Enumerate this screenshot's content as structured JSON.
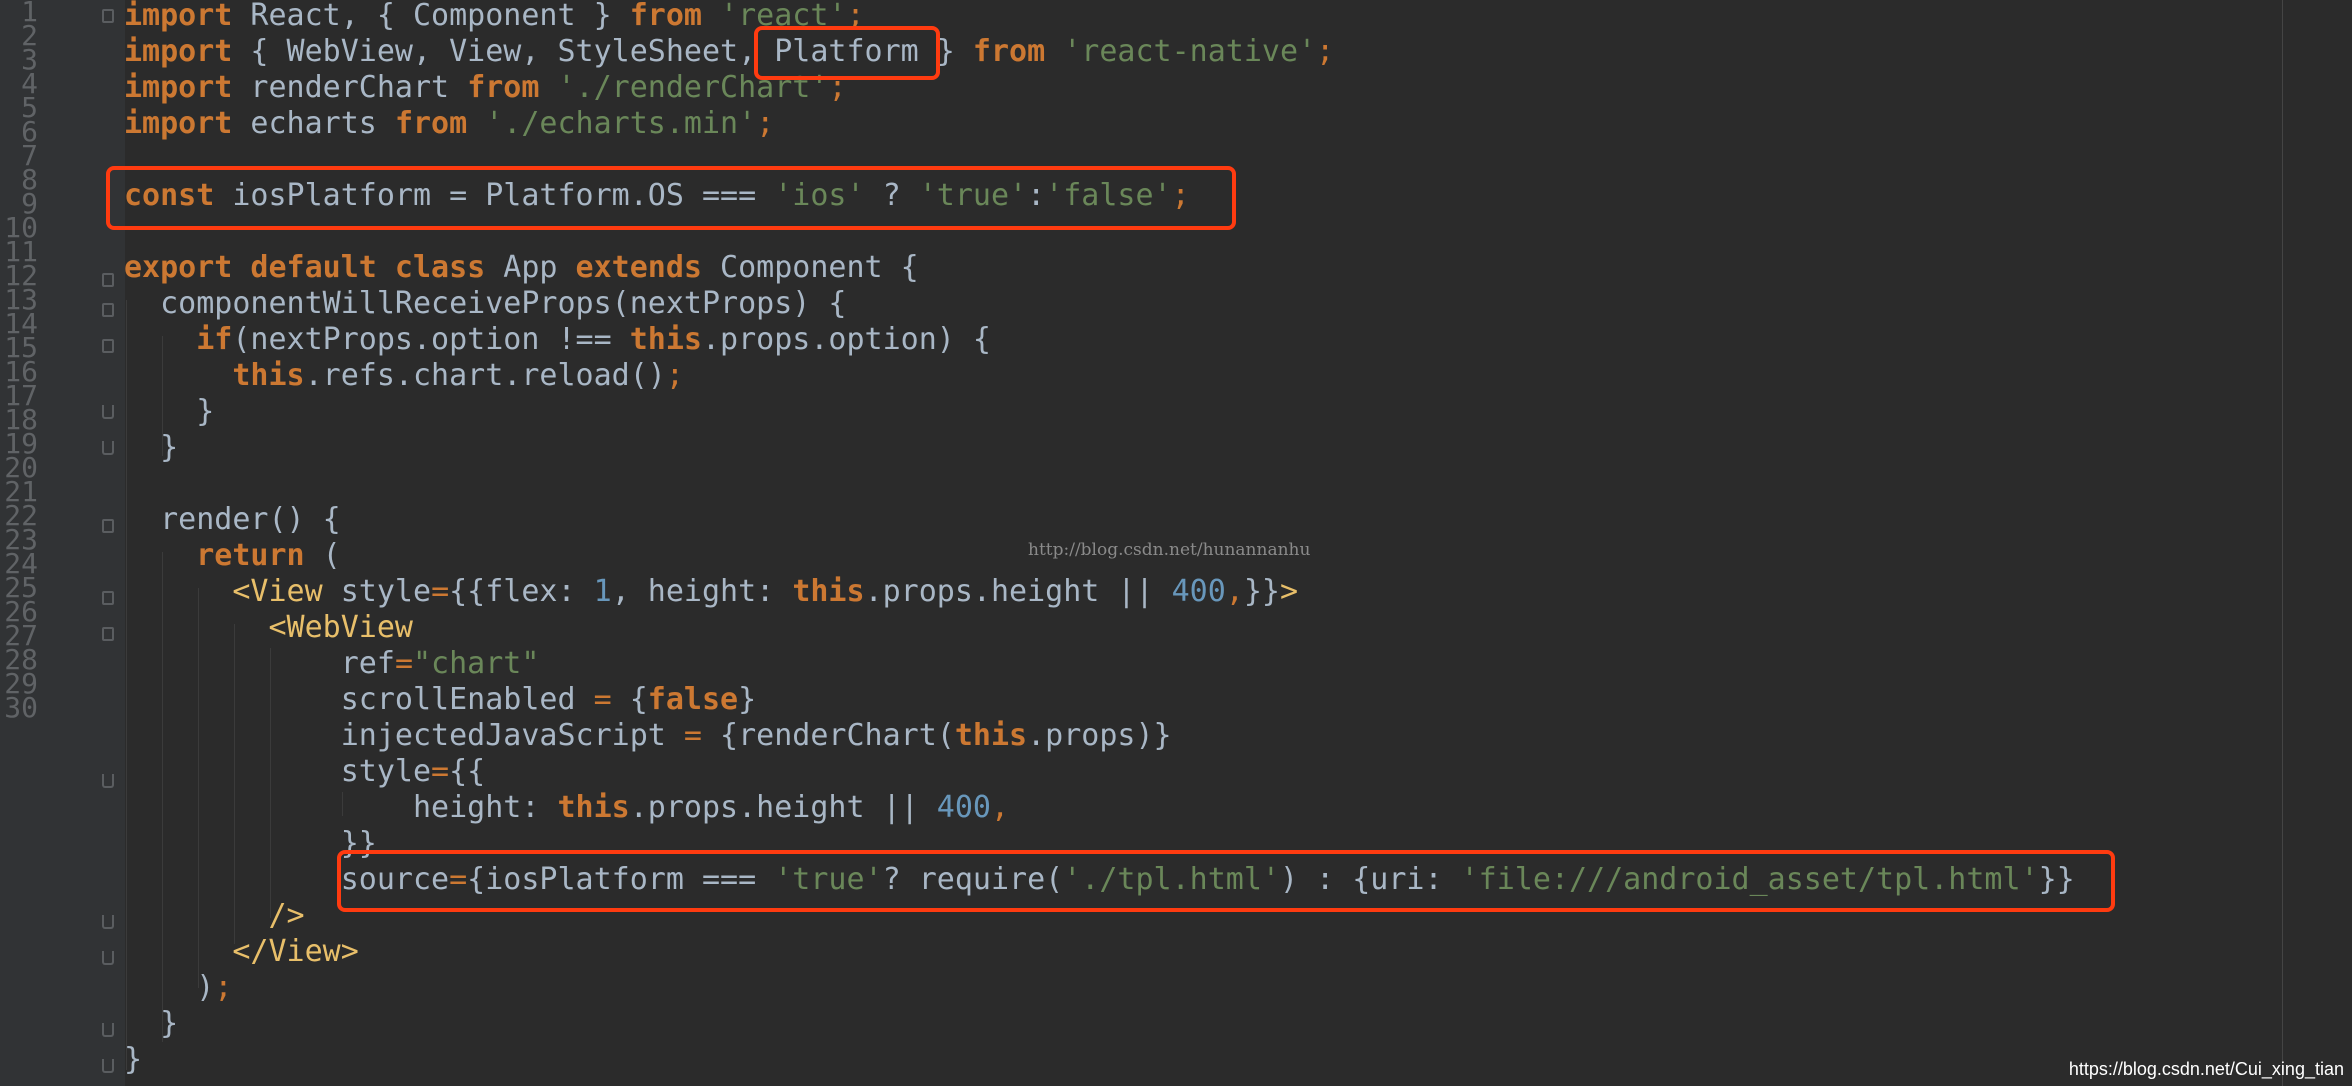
{
  "editor": {
    "line_numbers": [
      "1",
      "2",
      "3",
      "4",
      "5",
      "6",
      "7",
      "8",
      "9",
      "10",
      "11",
      "12",
      "13",
      "14",
      "15",
      "16",
      "17",
      "18",
      "19",
      "20",
      "21",
      "22",
      "23",
      "24",
      "25",
      "26",
      "27",
      "28",
      "29",
      "30"
    ],
    "lines": {
      "l1": [
        "import",
        " React, { Component } ",
        "from",
        " ",
        "'react'",
        ";"
      ],
      "l2": [
        "import",
        " { WebView, View, StyleSheet, Platform } ",
        "from",
        " ",
        "'react-native'",
        ";"
      ],
      "l3": [
        "import",
        " renderChart ",
        "from",
        " ",
        "'./renderChart'",
        ";"
      ],
      "l4": [
        "import",
        " echarts ",
        "from",
        " ",
        "'./echarts.min'",
        ";"
      ],
      "l6": [
        "const",
        " iosPlatform = Platform.OS === ",
        "'ios'",
        " ? ",
        "'true'",
        ":",
        "'false'",
        ";"
      ],
      "l8": [
        "export default class",
        " App ",
        "extends",
        " Component {"
      ],
      "l9": [
        "  componentWillReceiveProps(nextProps) {"
      ],
      "l10": [
        "    ",
        "if",
        "(nextProps.option !== ",
        "this",
        ".props.option) {"
      ],
      "l11": [
        "      ",
        "this",
        ".refs.chart.reload()",
        ";"
      ],
      "l12": [
        "    }"
      ],
      "l13": [
        "  }"
      ],
      "l15": [
        "  render() {"
      ],
      "l16": [
        "    ",
        "return",
        " ("
      ],
      "l17": [
        "      ",
        "<View",
        " style",
        "=",
        "{{flex: ",
        "1",
        ", height: ",
        "this",
        ".props.height || ",
        "400",
        ",",
        "}}",
        ">"
      ],
      "l18": [
        "        ",
        "<WebView"
      ],
      "l19": [
        "            ref",
        "=",
        "\"chart\""
      ],
      "l20": [
        "            scrollEnabled ",
        "=",
        " {",
        "false",
        "}"
      ],
      "l21": [
        "            injectedJavaScript ",
        "=",
        " {renderChart(",
        "this",
        ".props)}"
      ],
      "l22": [
        "            style",
        "=",
        "{{"
      ],
      "l23": [
        "                height: ",
        "this",
        ".props.height || ",
        "400",
        ","
      ],
      "l24": [
        "            }}"
      ],
      "l25": [
        "            source",
        "=",
        "{iosPlatform === ",
        "'true'",
        "? require(",
        "'./tpl.html'",
        ") : {uri: ",
        "'file:///android_asset/tpl.html'",
        "}}"
      ],
      "l26": [
        "        ",
        "/>"
      ],
      "l27": [
        "      ",
        "</View>"
      ],
      "l28": [
        "    )",
        ";"
      ],
      "l29": [
        "  }"
      ],
      "l30": [
        "}"
      ]
    }
  },
  "watermark_center": "http://blog.csdn.net/hunannanhu",
  "watermark_corner": "https://blog.csdn.net/Cui_xing_tian",
  "colors": {
    "background": "#2b2b2b",
    "keyword": "#cc7832",
    "string": "#6a8759",
    "number": "#6897bb",
    "tag": "#e8bf6a",
    "text": "#a9b7c6",
    "highlight_box": "#ff3b10"
  }
}
